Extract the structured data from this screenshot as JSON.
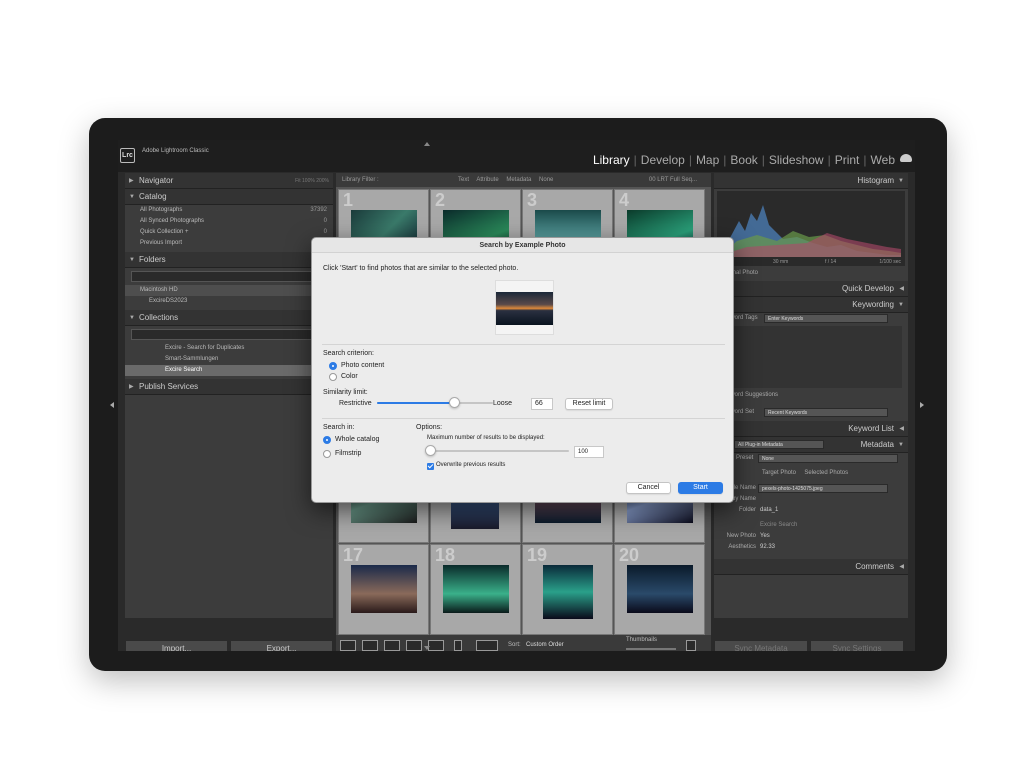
{
  "app": {
    "logo": "Lrc",
    "title": "Adobe Lightroom Classic",
    "modules": [
      "Library",
      "Develop",
      "Map",
      "Book",
      "Slideshow",
      "Print",
      "Web"
    ],
    "active_module": "Library"
  },
  "left_panel": {
    "navigator": {
      "label": "Navigator",
      "zoom_options": "Fit  100%  200%"
    },
    "catalog": {
      "label": "Catalog",
      "items": [
        {
          "label": "All Photographs",
          "count": "37392"
        },
        {
          "label": "All Synced Photographs",
          "count": "0"
        },
        {
          "label": "Quick Collection +",
          "count": "0"
        },
        {
          "label": "Previous Import",
          "count": ""
        }
      ]
    },
    "folders": {
      "label": "Folders",
      "items": [
        {
          "label": "Macintosh HD",
          "count": ""
        },
        {
          "label": "ExcireDS2023",
          "count": ""
        }
      ]
    },
    "collections": {
      "label": "Collections",
      "items": [
        {
          "label": "Excire - Search for Duplicates",
          "count": ""
        },
        {
          "label": "Smart-Sammlungen",
          "count": ""
        },
        {
          "label": "Excire Search",
          "count": "3"
        }
      ]
    },
    "publish": {
      "label": "Publish Services"
    },
    "import_label": "Import...",
    "export_label": "Export..."
  },
  "library_filter": {
    "title": "Library Filter :",
    "options": "Text  Attribute  Metadata  None",
    "preset": "00 LRT Full Seq..."
  },
  "grid": {
    "cells": [
      {
        "num": "1"
      },
      {
        "num": "2"
      },
      {
        "num": "3"
      },
      {
        "num": "4"
      },
      {
        "num": ""
      },
      {
        "num": ""
      },
      {
        "num": ""
      },
      {
        "num": ""
      },
      {
        "num": "17"
      },
      {
        "num": "18"
      },
      {
        "num": "19"
      },
      {
        "num": "20"
      }
    ]
  },
  "toolbar": {
    "sort_label": "Sort:",
    "sort_value": "Custom Order",
    "thumbnails_label": "Thumbnails"
  },
  "right_panel": {
    "histogram_label": "Histogram",
    "histogram_info": {
      "a": "100",
      "b": "30 mm",
      "c": "f / 14",
      "d": "1/100 sec"
    },
    "original_photo": "Original Photo",
    "quick_develop_label": "Quick Develop",
    "keywording_label": "Keywording",
    "keyword_tags_label": "Keyword Tags",
    "keyword_tags_value": "Enter Keywords",
    "keyword_suggestions_label": "Keyword Suggestions",
    "keyword_set_label": "Keyword Set",
    "keyword_set_value": "Recent Keywords",
    "keyword_list_label": "Keyword List",
    "metadata_label": "Metadata",
    "metadata_set": "All Plug-in Metadata",
    "preset_label": "Preset",
    "preset_value": "None",
    "target_photo": "Target Photo",
    "selected_photos": "Selected Photos",
    "file_name_label": "File Name",
    "file_name_value": "pexels-photo-1425075.jpeg",
    "copy_name_label": "Copy Name",
    "folder_label": "Folder",
    "folder_value": "data_1",
    "excire_label": "Excire Search",
    "new_photo_label": "New Photo",
    "new_photo_value": "Yes",
    "aesthetics_label": "Aesthetics",
    "aesthetics_value": "92.33",
    "comments_label": "Comments",
    "sync_metadata": "Sync Metadata",
    "sync_settings": "Sync Settings"
  },
  "dialog": {
    "title": "Search by Example Photo",
    "instruction": "Click 'Start' to find photos that are similar to the selected photo.",
    "criterion_label": "Search criterion:",
    "criterion_options": [
      "Photo content",
      "Color"
    ],
    "criterion_selected": "Photo content",
    "similarity_label": "Similarity limit:",
    "similarity_left": "Restrictive",
    "similarity_right": "Loose",
    "similarity_value": "66",
    "similarity_fraction": 0.66,
    "reset_label": "Reset limit",
    "search_in_label": "Search in:",
    "search_in_options": [
      "Whole catalog",
      "Filmstrip"
    ],
    "search_in_selected": "Whole catalog",
    "options_label": "Options:",
    "max_results_label": "Maximum number of results to be displayed:",
    "max_results_value": "100",
    "max_results_fraction": 0.02,
    "overwrite_label": "Overwrite previous results",
    "overwrite_checked": true,
    "cancel_label": "Cancel",
    "start_label": "Start"
  }
}
